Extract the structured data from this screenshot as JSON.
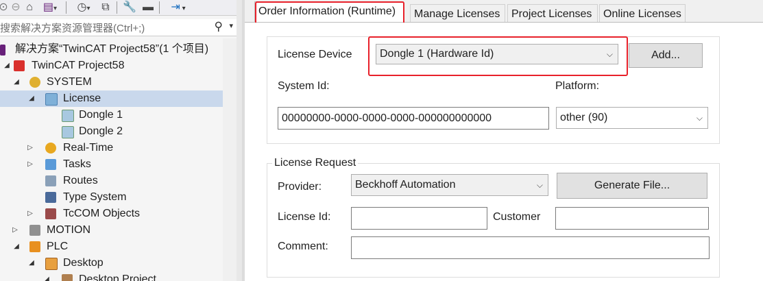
{
  "colors": {
    "highlight": "#e8202a",
    "selection": "#c9d8ec",
    "vs_purple": "#68217a"
  },
  "solution_explorer": {
    "search_placeholder": "搜索解决方案资源管理器(Ctrl+;)",
    "toolbar_icons": [
      "forward-icon",
      "back-icon",
      "home-icon",
      "solution-view-icon",
      "history-icon",
      "copy-icon",
      "wrench-icon",
      "minus-icon",
      "pin-icon"
    ],
    "tree": [
      {
        "label": "解决方案“TwinCAT Project58”(1 个项目)",
        "icon": "solution-icon"
      },
      {
        "label": "TwinCAT Project58",
        "icon": "project-icon"
      },
      {
        "label": "SYSTEM",
        "icon": "system-icon"
      },
      {
        "label": "License",
        "icon": "license-icon"
      },
      {
        "label": "Dongle 1",
        "icon": "dongle-icon"
      },
      {
        "label": "Dongle 2",
        "icon": "dongle-icon"
      },
      {
        "label": "Real-Time",
        "icon": "realtime-icon"
      },
      {
        "label": "Tasks",
        "icon": "tasks-icon"
      },
      {
        "label": "Routes",
        "icon": "routes-icon"
      },
      {
        "label": "Type System",
        "icon": "type-system-icon"
      },
      {
        "label": "TcCOM Objects",
        "icon": "tccom-icon"
      },
      {
        "label": "MOTION",
        "icon": "motion-icon"
      },
      {
        "label": "PLC",
        "icon": "plc-icon"
      },
      {
        "label": "Desktop",
        "icon": "plc-project-icon"
      },
      {
        "label": "Desktop Project",
        "icon": "plc-project-icon"
      }
    ]
  },
  "tabs": [
    {
      "label": "Order Information (Runtime)"
    },
    {
      "label": "Manage Licenses"
    },
    {
      "label": "Project Licenses"
    },
    {
      "label": "Online Licenses"
    }
  ],
  "order": {
    "license_device_label": "License Device",
    "license_device_value": "Dongle 1 (Hardware Id)",
    "add_button": "Add...",
    "system_id_label": "System Id:",
    "system_id_value": "00000000-0000-0000-0000-000000000000",
    "platform_label": "Platform:",
    "platform_value": "other (90)"
  },
  "license_request": {
    "title": "License Request",
    "provider_label": "Provider:",
    "provider_value": "Beckhoff Automation",
    "generate_button": "Generate File...",
    "license_id_label": "License Id:",
    "license_id_value": "",
    "customer_label": "Customer",
    "customer_value": "",
    "comment_label": "Comment:",
    "comment_value": ""
  }
}
